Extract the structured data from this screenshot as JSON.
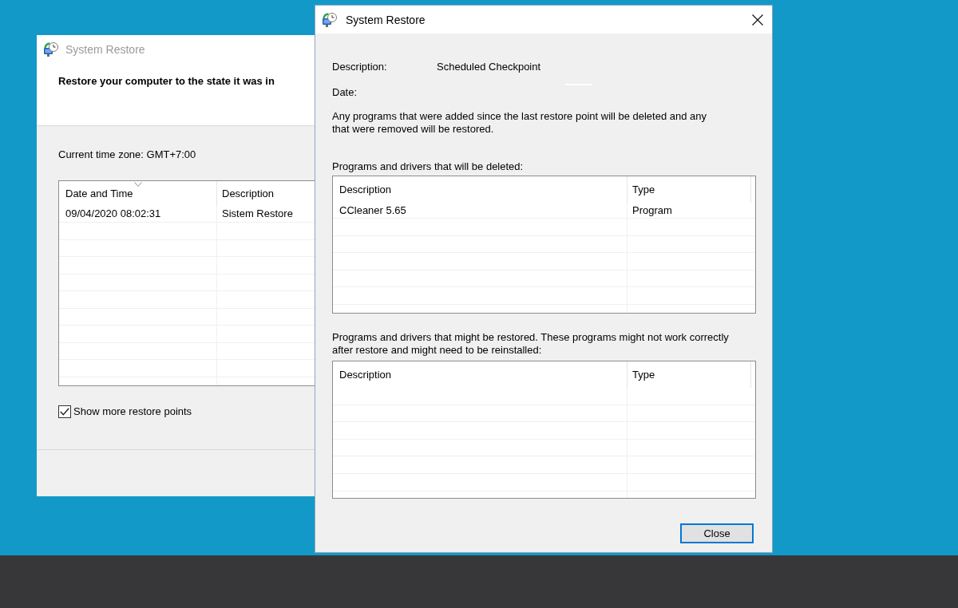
{
  "background_window": {
    "title": "System Restore",
    "active": false,
    "heading": "Restore your computer to the state it was in",
    "time_zone": "Current time zone: GMT+7:00",
    "table": {
      "columns": [
        {
          "label": "Date and Time",
          "sorted": true
        },
        {
          "label": "Description",
          "sorted": false
        }
      ],
      "rows": [
        {
          "cells": [
            "09/04/2020 08:02:31",
            "Sistem Restore"
          ],
          "selected": false
        }
      ]
    },
    "show_more": {
      "label": "Show more restore points",
      "checked": true
    }
  },
  "dialog": {
    "title": "System Restore",
    "active": true,
    "fields": [
      {
        "label": "Description:",
        "value": "Scheduled Checkpoint"
      },
      {
        "label": "Date:"
      }
    ],
    "note": "Any programs that were added since the last restore point will be deleted and any that were removed will be restored.",
    "lists": [
      {
        "caption": "Programs and drivers that will be deleted:",
        "columns": [
          "Description",
          "Type"
        ],
        "rows": [
          [
            "CCleaner 5.65",
            "Program"
          ]
        ]
      },
      {
        "caption": "Programs and drivers that might be restored. These programs might not work correctly after restore and might need to be reinstalled:",
        "columns": [
          "Description",
          "Type"
        ]
      }
    ],
    "buttons": [
      {
        "label": "Close",
        "default": true
      }
    ]
  }
}
